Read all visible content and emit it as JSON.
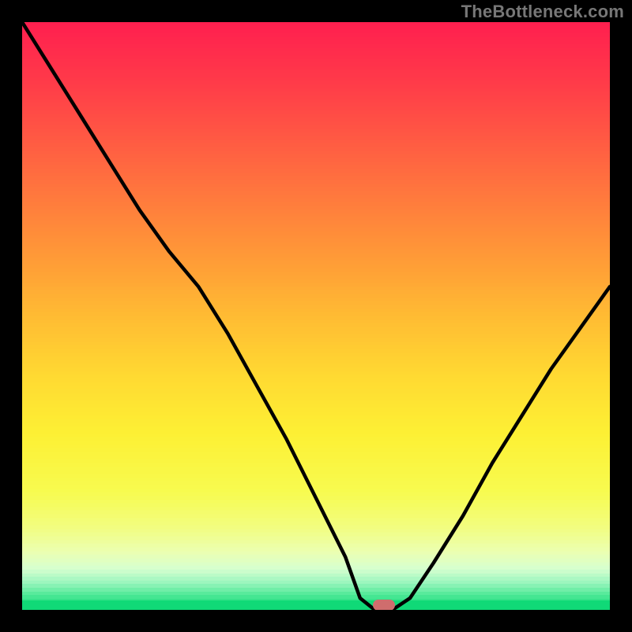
{
  "watermark": "TheBottleneck.com",
  "marker": {
    "x_frac": 0.615,
    "y_frac": 0.992,
    "color": "#cf6d6d"
  },
  "chart_data": {
    "type": "line",
    "title": "",
    "xlabel": "",
    "ylabel": "",
    "xlim": [
      0,
      1
    ],
    "ylim": [
      0,
      1
    ],
    "x": [
      0.0,
      0.05,
      0.1,
      0.15,
      0.2,
      0.25,
      0.3,
      0.35,
      0.4,
      0.45,
      0.5,
      0.55,
      0.575,
      0.6,
      0.63,
      0.66,
      0.7,
      0.75,
      0.8,
      0.85,
      0.9,
      0.95,
      1.0
    ],
    "y": [
      1.0,
      0.92,
      0.84,
      0.76,
      0.68,
      0.61,
      0.55,
      0.47,
      0.38,
      0.29,
      0.19,
      0.09,
      0.02,
      0.0,
      0.0,
      0.02,
      0.08,
      0.16,
      0.25,
      0.33,
      0.41,
      0.48,
      0.55
    ],
    "min_point": {
      "x": 0.615,
      "y": 0.0
    },
    "gradient_stops": [
      {
        "pos": 0.0,
        "color": "#ff1f4f"
      },
      {
        "pos": 0.1,
        "color": "#ff3a49"
      },
      {
        "pos": 0.2,
        "color": "#ff5a43"
      },
      {
        "pos": 0.3,
        "color": "#ff7a3d"
      },
      {
        "pos": 0.4,
        "color": "#ff9a37"
      },
      {
        "pos": 0.5,
        "color": "#ffbb33"
      },
      {
        "pos": 0.6,
        "color": "#ffd932"
      },
      {
        "pos": 0.7,
        "color": "#fdf034"
      },
      {
        "pos": 0.8,
        "color": "#f7fb50"
      },
      {
        "pos": 0.86,
        "color": "#f2fd80"
      },
      {
        "pos": 0.9,
        "color": "#ecffb0"
      },
      {
        "pos": 0.93,
        "color": "#d6ffcf"
      },
      {
        "pos": 0.955,
        "color": "#97f5bd"
      },
      {
        "pos": 0.975,
        "color": "#4de896"
      },
      {
        "pos": 1.0,
        "color": "#10d977"
      }
    ]
  }
}
